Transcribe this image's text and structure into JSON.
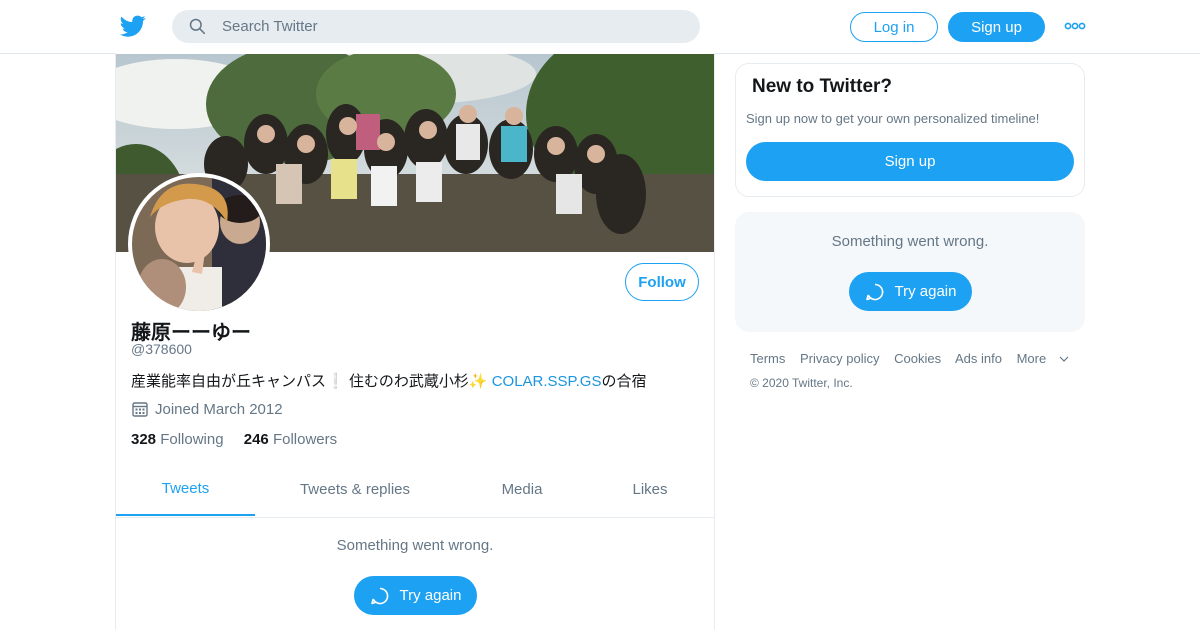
{
  "header": {
    "search_placeholder": "Search Twitter",
    "login_label": "Log in",
    "signup_label": "Sign up",
    "logo_icon": "twitter-bird-icon",
    "more_icon": "more-dots-icon",
    "accent_color": "#1da1f2"
  },
  "profile": {
    "name": "藤原ーーゆー",
    "handle": "@378600",
    "bio_text": "産業能率自由が丘キャンパス❕ 住むのわ武蔵小杉✨ ",
    "bio_link": "COLAR.SSP.GS",
    "bio_suffix": "の合宿",
    "joined": "Joined March 2012",
    "following_count": "328",
    "following_label": "Following",
    "followers_count": "246",
    "followers_label": "Followers",
    "follow_label": "Follow"
  },
  "tabs": [
    {
      "label": "Tweets",
      "active": true
    },
    {
      "label": "Tweets & replies",
      "active": false
    },
    {
      "label": "Media",
      "active": false
    },
    {
      "label": "Likes",
      "active": false
    }
  ],
  "timeline": {
    "error_text": "Something went wrong.",
    "retry_label": "Try again"
  },
  "sidebar": {
    "new_title": "New to Twitter?",
    "new_sub": "Sign up now to get your own personalized timeline!",
    "new_signup_label": "Sign up",
    "error_text": "Something went wrong.",
    "retry_label": "Try again"
  },
  "footer": {
    "links": [
      "Terms",
      "Privacy policy",
      "Cookies",
      "Ads info",
      "More"
    ],
    "copyright": "© 2020 Twitter, Inc."
  }
}
